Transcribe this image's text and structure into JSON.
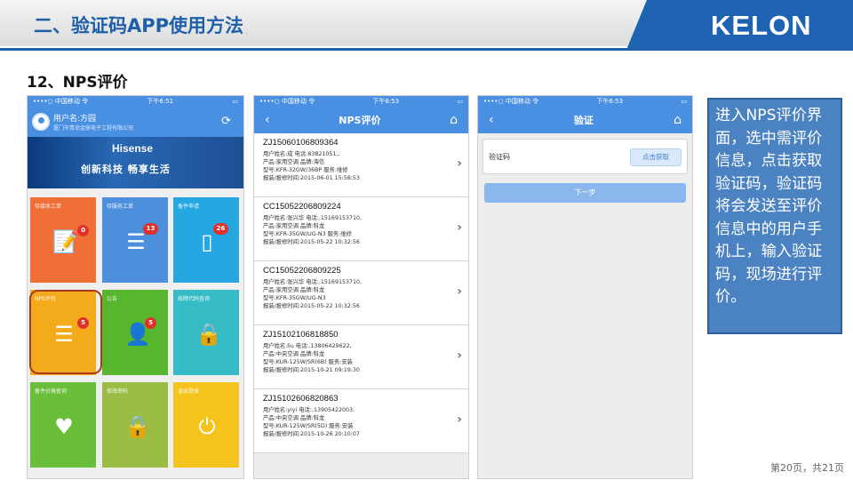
{
  "slide": {
    "title": "二、验证码APP使用方法",
    "logo": "KELON",
    "subtitle": "12、NPS评价",
    "page_number": "第20页，共21页"
  },
  "phone1": {
    "status_carrier": "••••○ 中国移动 令",
    "status_time": "下午6:51",
    "user_name": "用户名:方园",
    "user_company": "厦门市青岛金鼎电子工程有限公司",
    "banner_brand": "Hisense",
    "banner_slogan": "创新科技   畅享生活",
    "tiles": [
      {
        "label": "待接收工单",
        "badge": "0",
        "icon": "clipboard-icon",
        "color": "#f06f36"
      },
      {
        "label": "待服务工单",
        "badge": "13",
        "icon": "checklist-icon",
        "color": "#4c8fdc"
      },
      {
        "label": "备件申请",
        "badge": "26",
        "icon": "note-icon",
        "color": "#25a7e2"
      },
      {
        "label": "NPS评价",
        "badge": "5",
        "icon": "clipboard-list-icon",
        "color": "#f4ab1b"
      },
      {
        "label": "公告",
        "badge": "5",
        "icon": "person-icon",
        "color": "#58b62e"
      },
      {
        "label": "故障代码查询",
        "badge": "",
        "icon": "lock-icon",
        "color": "#36bcc7"
      },
      {
        "label": "备件价格查询",
        "badge": "",
        "icon": "heart-icon",
        "color": "#6abf3a"
      },
      {
        "label": "修改密码",
        "badge": "",
        "icon": "lock-icon",
        "color": "#9bbd45"
      },
      {
        "label": "退出登录",
        "badge": "",
        "icon": "power-icon",
        "color": "#f4c41d"
      }
    ]
  },
  "phone2": {
    "status_carrier": "••••○ 中国移动 令",
    "status_time": "下午6:53",
    "nav_title": "NPS评价",
    "records": [
      {
        "id": "ZJ15060106809364",
        "l1": "用户姓名:成  电话:83821051,,",
        "l2": "产品:家用空调  品牌:海信",
        "l3": "型号:KFR-32GW/36BP  服务:维修",
        "l4": "报装/报修时间:2015-06-01 15:58:53"
      },
      {
        "id": "CC15052206809224",
        "l1": "用户姓名:张兴华  电话:,15169153710,",
        "l2": "产品:家用空调  品牌:科龙",
        "l3": "型号:KFR-35GW/UG-N3  服务:维修",
        "l4": "报装/报修时间:2015-05-22 10:32:56"
      },
      {
        "id": "CC15052206809225",
        "l1": "用户姓名:张兴华  电话:,15169153710,",
        "l2": "产品:家用空调  品牌:科龙",
        "l3": "型号:KFR-35GW/UG-N3",
        "l4": "报装/报修时间:2015-05-22 10:32:56"
      },
      {
        "id": "ZJ15102106818850",
        "l1": "用户姓名:liu  电话:,13806429622,",
        "l2": "产品:中央空调  品牌:科龙",
        "l3": "型号:KUR-125W/SR(6B)  服务:安装",
        "l4": "报装/报修时间:2015-10-21 09:19:30"
      },
      {
        "id": "ZJ15102606820863",
        "l1": "用户姓名:yiyi  电话:,13905422003,",
        "l2": "产品:中央空调  品牌:科龙",
        "l3": "型号:KUR-125W/SR(5D)  服务:安装",
        "l4": "报装/报修时间:2015-10-26 20:10:07"
      }
    ]
  },
  "phone3": {
    "status_carrier": "••••○ 中国移动 令",
    "status_time": "下午6:53",
    "nav_title": "验证",
    "code_label": "验证码",
    "get_code_button": "点击获取",
    "next_button": "下一步"
  },
  "description": "进入NPS评价界面，选中需评价信息，点击获取验证码，验证码将会发送至评价信息中的用户手机上，输入验证码，现场进行评价。"
}
